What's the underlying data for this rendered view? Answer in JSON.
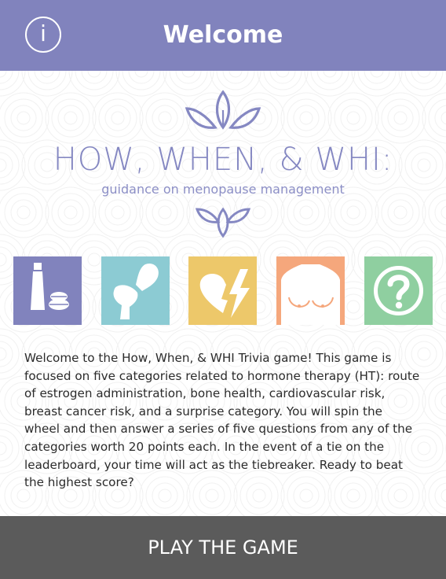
{
  "header": {
    "title": "Welcome",
    "info_label": "i"
  },
  "logo": {
    "title": "HOW, WHEN, & WHI:",
    "subtitle": "guidance on menopause management"
  },
  "categories": [
    {
      "icon": "estrogen-cream-pills-icon",
      "color": "#8183bd"
    },
    {
      "icon": "bone-joint-icon",
      "color": "#8ccbd3"
    },
    {
      "icon": "heart-lightning-icon",
      "color": "#edc86a"
    },
    {
      "icon": "breast-torso-icon",
      "color": "#f5a77c"
    },
    {
      "icon": "question-mark-icon",
      "color": "#8fcfa0"
    }
  ],
  "description": "Welcome to the How, When, & WHI Trivia game! This game is focused on five categories related to hormone therapy (HT): route of estrogen administration, bone health, cardiovascular risk, breast cancer risk, and a surprise category. You will spin the wheel and then answer a series of five questions from any of the categories worth 20 points each. In the event of a tie on the leaderboard, your time will act as the tiebreaker. Ready to beat the highest score?",
  "play_button": {
    "label": "PLAY THE GAME"
  },
  "colors": {
    "header": "#8183bd",
    "logo": "#8588c2",
    "play_button": "#5b5b5b"
  }
}
